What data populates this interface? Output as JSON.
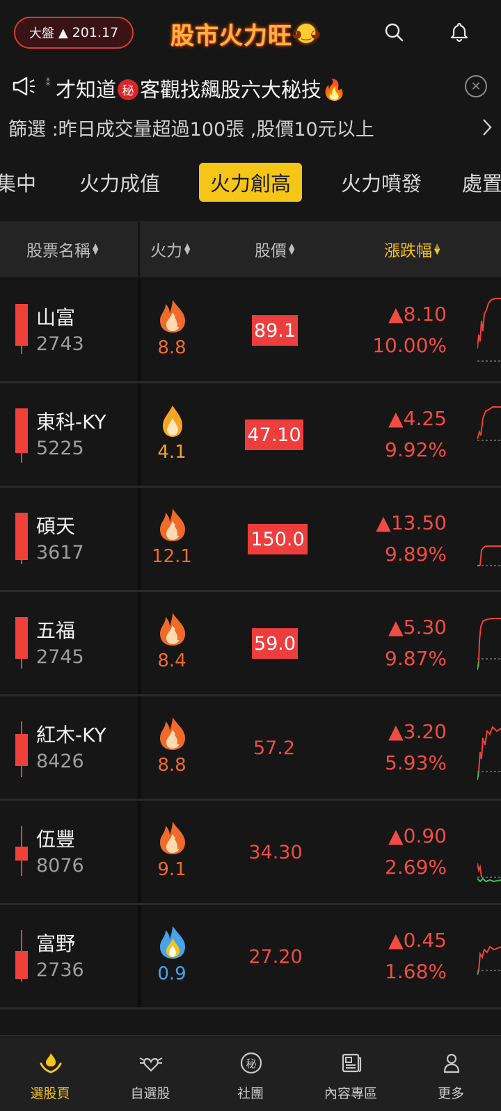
{
  "header": {
    "market_label": "大盤",
    "market_change": "201.17",
    "brand": "股市火力旺",
    "search_icon": "search-icon",
    "bell_icon": "bell-icon"
  },
  "promo": {
    "marks": "⁑",
    "text_before": "才知道",
    "badge": "秘",
    "text_after": "客觀找飆股六大秘技🔥"
  },
  "filter": {
    "text": "篩選 :昨日成交量超過100張 ,股價10元以上"
  },
  "tabs": [
    {
      "label": "集中"
    },
    {
      "label": "火力成值"
    },
    {
      "label": "火力創高"
    },
    {
      "label": "火力噴發"
    },
    {
      "label": "處置"
    }
  ],
  "columns": {
    "name": "股票名稱",
    "fire": "火力",
    "price": "股價",
    "change": "漲跌幅"
  },
  "colors": {
    "up": "#f14c44",
    "accent": "#f5c518",
    "fire_orange": "#f06a2a",
    "fire_yellow": "#f5a524",
    "fire_blue": "#4aa3e8"
  },
  "stocks": [
    {
      "name": "山富",
      "code": "2743",
      "fire": "8.8",
      "fire_level": "high",
      "price": "89.1",
      "limit_up": true,
      "change": "8.10",
      "pct": "10.00%"
    },
    {
      "name": "東科-KY",
      "code": "5225",
      "fire": "4.1",
      "fire_level": "mid",
      "price": "47.10",
      "limit_up": true,
      "change": "4.25",
      "pct": "9.92%"
    },
    {
      "name": "碩天",
      "code": "3617",
      "fire": "12.1",
      "fire_level": "high",
      "price": "150.0",
      "limit_up": true,
      "change": "13.50",
      "pct": "9.89%"
    },
    {
      "name": "五福",
      "code": "2745",
      "fire": "8.4",
      "fire_level": "high",
      "price": "59.0",
      "limit_up": true,
      "change": "5.30",
      "pct": "9.87%"
    },
    {
      "name": "紅木-KY",
      "code": "8426",
      "fire": "8.8",
      "fire_level": "high",
      "price": "57.2",
      "limit_up": false,
      "change": "3.20",
      "pct": "5.93%"
    },
    {
      "name": "伍豐",
      "code": "8076",
      "fire": "9.1",
      "fire_level": "high",
      "price": "34.30",
      "limit_up": false,
      "change": "0.90",
      "pct": "2.69%"
    },
    {
      "name": "富野",
      "code": "2736",
      "fire": "0.9",
      "fire_level": "low",
      "price": "27.20",
      "limit_up": false,
      "change": "0.45",
      "pct": "1.68%"
    }
  ],
  "bottom_nav": [
    {
      "label": "選股頁",
      "icon": "fire-hands-icon",
      "active": true
    },
    {
      "label": "自選股",
      "icon": "winged-heart-icon",
      "active": false
    },
    {
      "label": "社團",
      "icon": "secret-badge-icon",
      "active": false
    },
    {
      "label": "內容專區",
      "icon": "newspaper-icon",
      "active": false
    },
    {
      "label": "更多",
      "icon": "person-icon",
      "active": false
    }
  ]
}
